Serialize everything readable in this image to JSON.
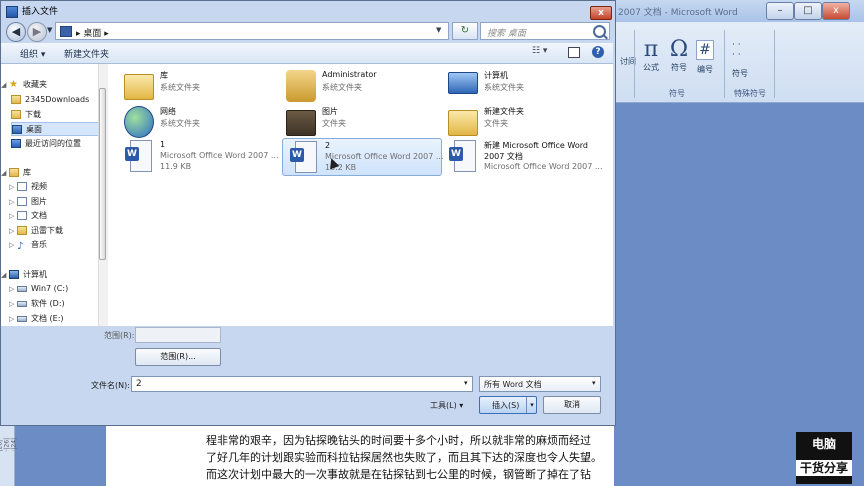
{
  "word": {
    "title": "2007 文档 - Microsoft Word",
    "ribbon": {
      "equation": "公式",
      "symbol": "符号",
      "number": "编号",
      "special_symbol": "特殊符号",
      "group_symbol": "符号",
      "group_special": "特殊符号",
      "special_dd": "符号",
      "dots": "· ·\n· ·",
      "pi_glyph": "π",
      "omega_glyph": "Ω",
      "number_glyph": "#"
    },
    "doc_lines": [
      "程非常的艰辛，因为钻探晚钻头的时间要十多个小时，所以就非常的麻烦而经过",
      "了好几年的计划跟实验而科拉钻探居然也失败了，而且其下达的深度也令人失望。",
      "而这次计划中最大的一次事故就是在钻探钻到七公里的时候，钢管断了掉在了钻"
    ],
    "ruler_marks": "|28|·|26|·|24|",
    "watermark_line1": "电脑",
    "watermark_line2": "干货分享"
  },
  "dialog": {
    "title": "插入文件",
    "close": "x",
    "address": {
      "crumb": "桌面",
      "sep": "▸"
    },
    "search_placeholder": "搜索 桌面",
    "toolbar": {
      "organize": "组织 ▾",
      "new_folder": "新建文件夹",
      "views": "☷ ▾",
      "help": "?"
    },
    "nav": [
      {
        "label": "收藏夹",
        "arrow": "◢",
        "icon": "star",
        "indent": 0
      },
      {
        "label": "2345Downloads",
        "arrow": "",
        "icon": "folder",
        "indent": 1
      },
      {
        "label": "下载",
        "arrow": "",
        "icon": "folder",
        "indent": 1
      },
      {
        "label": "桌面",
        "arrow": "",
        "icon": "desktop",
        "indent": 1,
        "selected": true
      },
      {
        "label": "最近访问的位置",
        "arrow": "",
        "icon": "recent",
        "indent": 1
      },
      {
        "label": "库",
        "arrow": "◢",
        "icon": "library",
        "indent": 0
      },
      {
        "label": "视频",
        "arrow": "▷",
        "icon": "video",
        "indent": 1
      },
      {
        "label": "图片",
        "arrow": "▷",
        "icon": "picture",
        "indent": 1
      },
      {
        "label": "文档",
        "arrow": "▷",
        "icon": "doc",
        "indent": 1
      },
      {
        "label": "迅雷下载",
        "arrow": "▷",
        "icon": "folder",
        "indent": 1
      },
      {
        "label": "音乐",
        "arrow": "▷",
        "icon": "music",
        "indent": 1
      },
      {
        "label": "计算机",
        "arrow": "◢",
        "icon": "computer",
        "indent": 0
      },
      {
        "label": "Win7 (C:)",
        "arrow": "▷",
        "icon": "drive",
        "indent": 1
      },
      {
        "label": "软件 (D:)",
        "arrow": "▷",
        "icon": "drive",
        "indent": 1
      },
      {
        "label": "文档 (E:)",
        "arrow": "▷",
        "icon": "drive",
        "indent": 1
      }
    ],
    "files": [
      {
        "name": "库",
        "line2": "系统文件夹",
        "line3": "",
        "icon": "library"
      },
      {
        "name": "Administrator",
        "line2": "系统文件夹",
        "line3": "",
        "icon": "user-folder"
      },
      {
        "name": "计算机",
        "line2": "系统文件夹",
        "line3": "",
        "icon": "computer"
      },
      {
        "name": "网络",
        "line2": "系统文件夹",
        "line3": "",
        "icon": "network"
      },
      {
        "name": "图片",
        "line2": "文件夹",
        "line3": "",
        "icon": "folder"
      },
      {
        "name": "新建文件夹",
        "line2": "文件夹",
        "line3": "",
        "icon": "folder"
      },
      {
        "name": "1",
        "line2": "Microsoft Office Word 2007 ...",
        "line3": "11.9 KB",
        "icon": "word-doc"
      },
      {
        "name": "2",
        "line2": "Microsoft Office Word 2007 ...",
        "line3": "10.2 KB",
        "icon": "word-doc",
        "selected": true
      },
      {
        "name": "新建 Microsoft Office Word",
        "line2": "2007 文档",
        "line3": "Microsoft Office Word 2007 ...",
        "icon": "word-doc"
      }
    ],
    "range_label": "范围(R):",
    "range_button": "范围(R)...",
    "filename_label": "文件名(N):",
    "filename_value": "2",
    "filetype_value": "所有 Word 文档",
    "tools_label": "工具(L)",
    "tools_dd": "▾",
    "insert_button": "插入(S)",
    "cancel_button": "取消",
    "dd_arrow": "▾"
  }
}
